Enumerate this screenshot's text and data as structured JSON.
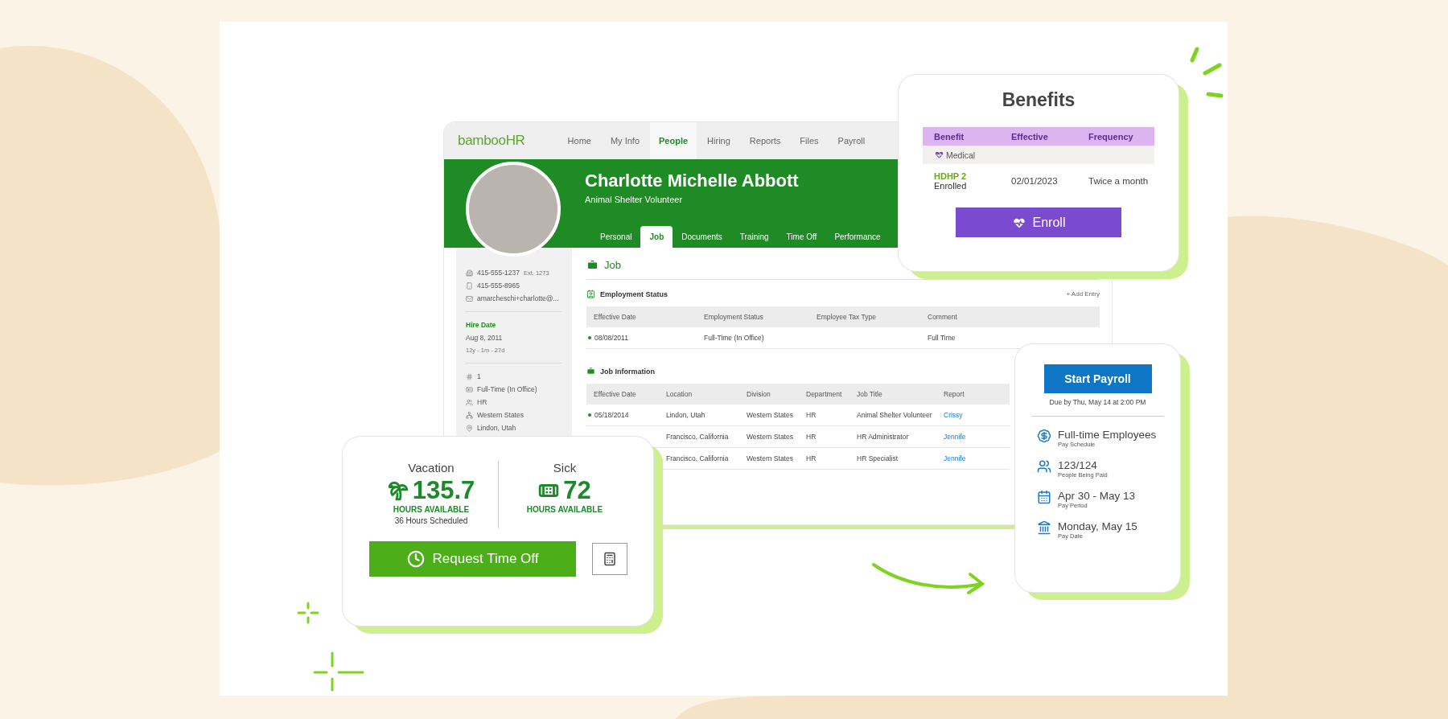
{
  "app": {
    "logo": "bambooHR",
    "nav": [
      {
        "label": "Home",
        "selected": false
      },
      {
        "label": "My Info",
        "selected": false
      },
      {
        "label": "People",
        "selected": true
      },
      {
        "label": "Hiring",
        "selected": false
      },
      {
        "label": "Reports",
        "selected": false
      },
      {
        "label": "Files",
        "selected": false
      },
      {
        "label": "Payroll",
        "selected": false
      }
    ],
    "profile": {
      "name": "Charlotte Michelle Abbott",
      "title": "Animal Shelter Volunteer"
    },
    "tabs": [
      {
        "label": "Personal",
        "selected": false
      },
      {
        "label": "Job",
        "selected": true
      },
      {
        "label": "Documents",
        "selected": false
      },
      {
        "label": "Training",
        "selected": false
      },
      {
        "label": "Time Off",
        "selected": false
      },
      {
        "label": "Performance",
        "selected": false
      }
    ],
    "sidebar": {
      "contacts": [
        {
          "kind": "phone",
          "text": "415-555-1237",
          "extra": "Ext. 1273"
        },
        {
          "kind": "mobile",
          "text": "415-555-8965"
        },
        {
          "kind": "email",
          "text": "amarcheschi+charlotte@..."
        }
      ],
      "hire_date": {
        "label": "Hire Date",
        "date": "Aug 8, 2011",
        "tenure": "12y - 1m - 27d"
      },
      "details": [
        {
          "kind": "id",
          "text": "1"
        },
        {
          "kind": "employment",
          "text": "Full-Time (In Office)"
        },
        {
          "kind": "department",
          "text": "HR"
        },
        {
          "kind": "division",
          "text": "Western States"
        },
        {
          "kind": "location",
          "text": "Lindon, Utah"
        }
      ]
    },
    "section_title": "Job",
    "employment_status": {
      "title": "Employment Status",
      "action": "+ Add Entry",
      "columns": [
        "Effective Date",
        "Employment Status",
        "Employee Tax Type",
        "Comment"
      ],
      "rows": [
        {
          "current": true,
          "cells": [
            "08/08/2011",
            "Full-Time (In Office)",
            "",
            "Full Time"
          ]
        }
      ]
    },
    "job_information": {
      "title": "Job Information",
      "columns": [
        "Effective Date",
        "Location",
        "Division",
        "Department",
        "Job Title",
        "Report"
      ],
      "rows": [
        {
          "current": true,
          "date": "05/18/2014",
          "location": "Lindon, Utah",
          "division": "Western States",
          "department": "HR",
          "job_title": "Animal Shelter Volunteer",
          "report": "Crissy"
        },
        {
          "location": "Francisco, California",
          "division": "Western States",
          "department": "HR",
          "job_title": "HR Administrator",
          "report": "Jennife"
        },
        {
          "location": "Francisco, California",
          "division": "Western States",
          "department": "HR",
          "job_title": "HR Specialist",
          "report": "Jennife"
        }
      ]
    }
  },
  "benefits": {
    "title": "Benefits",
    "columns": [
      "Benefit",
      "Effective",
      "Frequency"
    ],
    "group": "Medical",
    "plan": "HDHP 2",
    "status": "Enrolled",
    "effective": "02/01/2023",
    "frequency": "Twice a month",
    "button": "Enroll"
  },
  "payroll": {
    "button": "Start Payroll",
    "due": "Due by Thu, May 14 at 2:00 PM",
    "items": [
      {
        "kind": "schedule",
        "title": "Full-time Employees",
        "caption": "Pay Schedule"
      },
      {
        "kind": "people",
        "title": "123/124",
        "caption": "People Being Paid"
      },
      {
        "kind": "period",
        "title": "Apr 30 - May 13",
        "caption": "Pay Period"
      },
      {
        "kind": "paydate",
        "title": "Monday, May 15",
        "caption": "Pay Date"
      }
    ]
  },
  "time_off": {
    "balances": [
      {
        "kind": "vacation",
        "label": "Vacation",
        "hours": "135.7",
        "unit": "HOURS AVAILABLE",
        "scheduled": "36 Hours Scheduled"
      },
      {
        "kind": "sick",
        "label": "Sick",
        "hours": "72",
        "unit": "HOURS AVAILABLE"
      }
    ],
    "button": "Request Time Off"
  }
}
